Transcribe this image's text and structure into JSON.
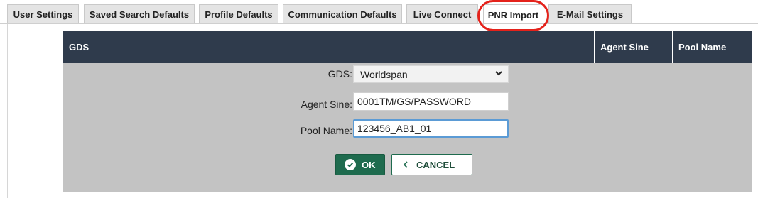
{
  "tabs": [
    {
      "label": "User Settings",
      "active": false
    },
    {
      "label": "Saved Search Defaults",
      "active": false
    },
    {
      "label": "Profile Defaults",
      "active": false
    },
    {
      "label": "Communication Defaults",
      "active": false
    },
    {
      "label": "Live Connect",
      "active": false
    },
    {
      "label": "PNR Import",
      "active": true
    },
    {
      "label": "E-Mail Settings",
      "active": false
    }
  ],
  "table": {
    "headers": {
      "gds": "GDS",
      "agent_sine": "Agent Sine",
      "pool_name": "Pool Name"
    }
  },
  "form": {
    "gds_label": "GDS:",
    "gds_value": "Worldspan",
    "agent_sine_label": "Agent Sine:",
    "agent_sine_value": "0001TM/GS/PASSWORD",
    "pool_name_label": "Pool Name:",
    "pool_name_value": "123456_AB1_01",
    "ok_label": "OK",
    "cancel_label": "CANCEL"
  },
  "colors": {
    "header_bg": "#2f3b4c",
    "panel_bg": "#c3c3c3",
    "ok_button": "#1e6b4e",
    "highlight": "#e4221b"
  }
}
